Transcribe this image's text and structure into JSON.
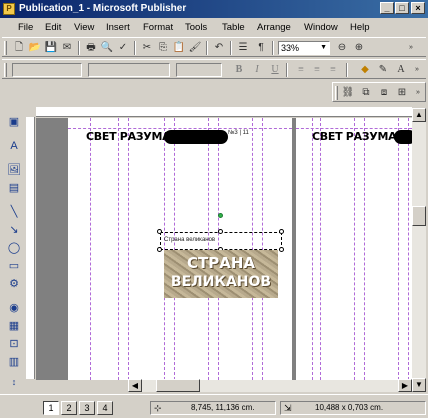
{
  "window": {
    "title": "Publication_1 - Microsoft Publisher"
  },
  "menu": [
    "File",
    "Edit",
    "View",
    "Insert",
    "Format",
    "Tools",
    "Table",
    "Arrange",
    "Window",
    "Help"
  ],
  "toolbar": {
    "zoom": "33%"
  },
  "publication": {
    "header_left": "СВЕТ РАЗУМА",
    "header_right": "СВЕТ РАЗУМА",
    "issue_label": "№3 | 11",
    "caption": "Страна великанов",
    "image_line1": "СТРАНА",
    "image_line2": "ВЕЛИКАНОВ"
  },
  "status": {
    "pages": [
      "1",
      "2",
      "3",
      "4"
    ],
    "position": "8,745, 11,136 cm.",
    "size": "10,488 x 0,703 cm."
  }
}
